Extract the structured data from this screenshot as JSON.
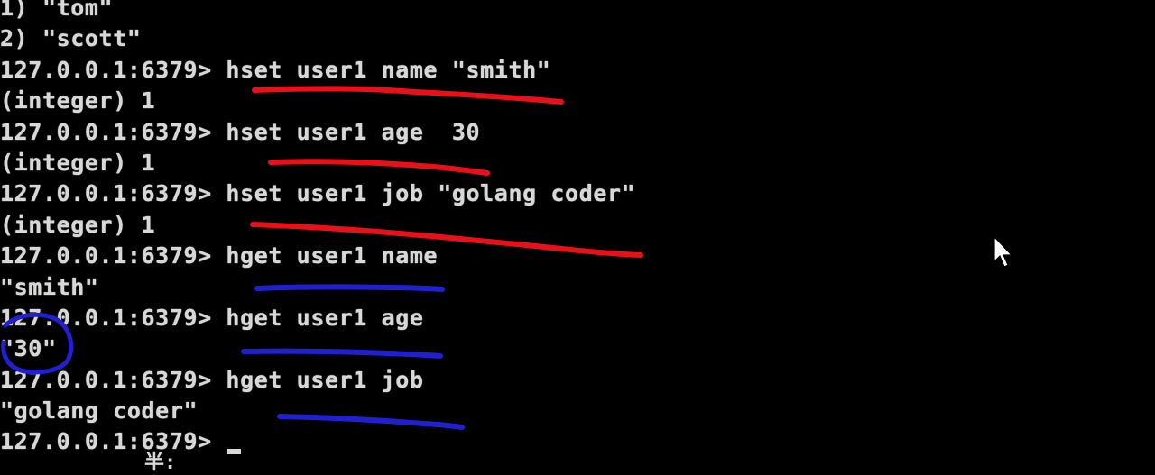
{
  "terminal": {
    "lines": [
      "1) \"tom\"",
      "2) \"scott\"",
      "127.0.0.1:6379> hset user1 name \"smith\"",
      "(integer) 1",
      "127.0.0.1:6379> hset user1 age  30",
      "(integer) 1",
      "127.0.0.1:6379> hset user1 job \"golang coder\"",
      "(integer) 1",
      "127.0.0.1:6379> hget user1 name",
      "\"smith\"",
      "127.0.0.1:6379> hget user1 age",
      "\"30\"",
      "127.0.0.1:6379> hget user1 job",
      "\"golang coder\"",
      "127.0.0.1:6379> "
    ],
    "ime_glyph": "半:"
  },
  "colors": {
    "background": "#000000",
    "text": "#d8d8d8",
    "set_underline": "#e8101a",
    "get_underline": "#2020d0"
  },
  "icons": {
    "pointer": "mouse-pointer-icon"
  }
}
